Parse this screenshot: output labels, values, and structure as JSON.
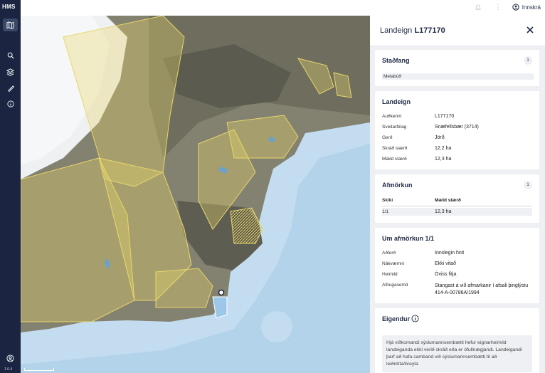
{
  "app": {
    "logo": "HMS",
    "version": "1.6.4"
  },
  "topbar": {
    "login_label": "Innskrá"
  },
  "panel": {
    "title_prefix": "Landeign",
    "title_id": "L177170",
    "stadfang": {
      "title": "Staðfang",
      "count": "1",
      "value": "Melabúð"
    },
    "landeign": {
      "title": "Landeign",
      "rows": [
        {
          "label": "Auðkenni",
          "value": "L177170"
        },
        {
          "label": "Sveitarfélag",
          "value": "Snæfellsbær (3714)"
        },
        {
          "label": "Gerð",
          "value": "Jörð"
        },
        {
          "label": "Skráð stærð",
          "value": "12,2 ha"
        },
        {
          "label": "Mæld stærð",
          "value": "12,3 ha"
        }
      ]
    },
    "afmorkun": {
      "title": "Afmörkun",
      "count": "1",
      "col1": "Skiki",
      "col2": "Mæld stærð",
      "row": {
        "skiki": "1/1",
        "size": "12,3 ha"
      }
    },
    "um_afmorkun": {
      "title": "Um afmörkun 1/1",
      "rows": [
        {
          "label": "Aðferð",
          "value": "Innslegin hnit"
        },
        {
          "label": "Nákvæmni",
          "value": "Ekki vitað"
        },
        {
          "label": "Heimild",
          "value": "Óviss fitja"
        },
        {
          "label": "Athugasemd",
          "value": "Stangast á við afmarkanir í afsali þinglýstu 414-A-00786A/1994"
        }
      ]
    },
    "eigendur": {
      "title": "Eigendur",
      "notice": "Hjá viðkomandi sýslumannsembætti hefur eignarheimild landeiganda ekki verið skráð eða er ófullnægjandi. Landeigandi þarf að hafa samband við sýslumannsembætti til að leiðrétta/breyta"
    }
  },
  "colors": {
    "sidebar": "#1b2542",
    "parcel": "#e8d66a",
    "sea": "#c3dcef",
    "glacier": "#e9ecef"
  }
}
